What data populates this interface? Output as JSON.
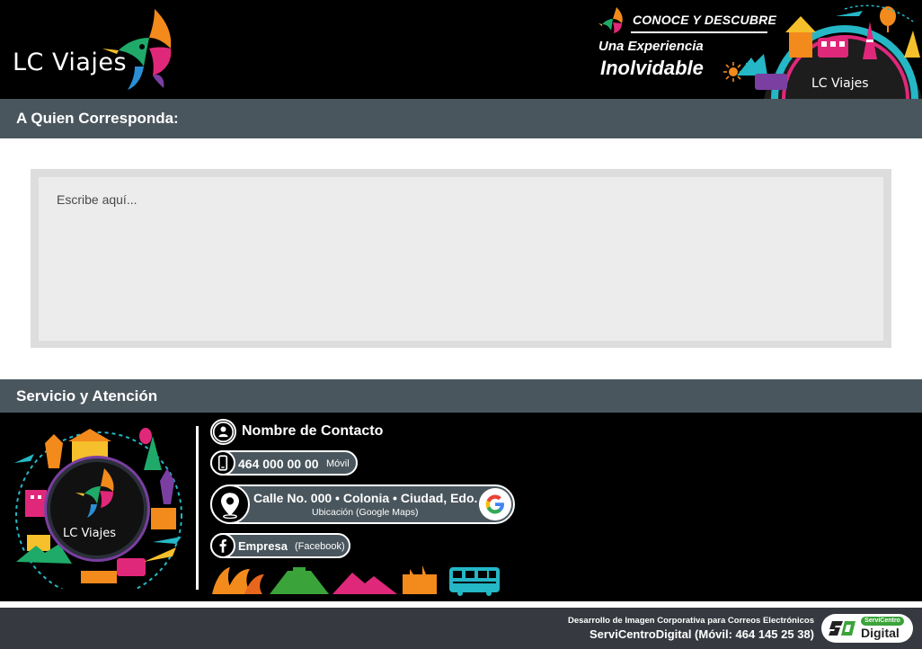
{
  "header": {
    "brand": "LC Viajes",
    "promo": {
      "line1": "CONOCE Y DESCUBRE",
      "line2": "Una Experiencia",
      "line3": "Inolvidable",
      "brand": "LC Viajes"
    }
  },
  "greeting": {
    "label": "A Quien Corresponda:"
  },
  "message": {
    "placeholder": "Escribe aquí..."
  },
  "service": {
    "label": "Servicio y Atención"
  },
  "contact": {
    "badge_label": "LC Viajes",
    "name": "Nombre de Contacto",
    "phone": {
      "number": "464 000 00 00",
      "label": "Móvil"
    },
    "address": {
      "text": "Calle No. 000 • Colonia • Ciudad, Edo.",
      "label": "Ubicación (Google Maps)"
    },
    "facebook": {
      "name": "Empresa",
      "label": "(Facebook)"
    }
  },
  "credit": {
    "line1": "Desarrollo de Imagen Corporativa para Correos Electrónicos",
    "line2": "ServiCentroDigital (Móvil: 464 145 25 38)",
    "logo_tag": "ServiCentro",
    "logo_word": "Digital"
  },
  "colors": {
    "header_bg": "#000000",
    "bar": "#4a565d",
    "credit_bar": "#363a40",
    "accent_magenta": "#e0287a",
    "accent_orange": "#f28a1c",
    "accent_green": "#3aa33a"
  },
  "icons": [
    "hummingbird-logo-icon",
    "sun-icon",
    "person-icon",
    "mobile-phone-icon",
    "map-pin-icon",
    "google-icon",
    "facebook-icon",
    "landmarks-icon"
  ]
}
